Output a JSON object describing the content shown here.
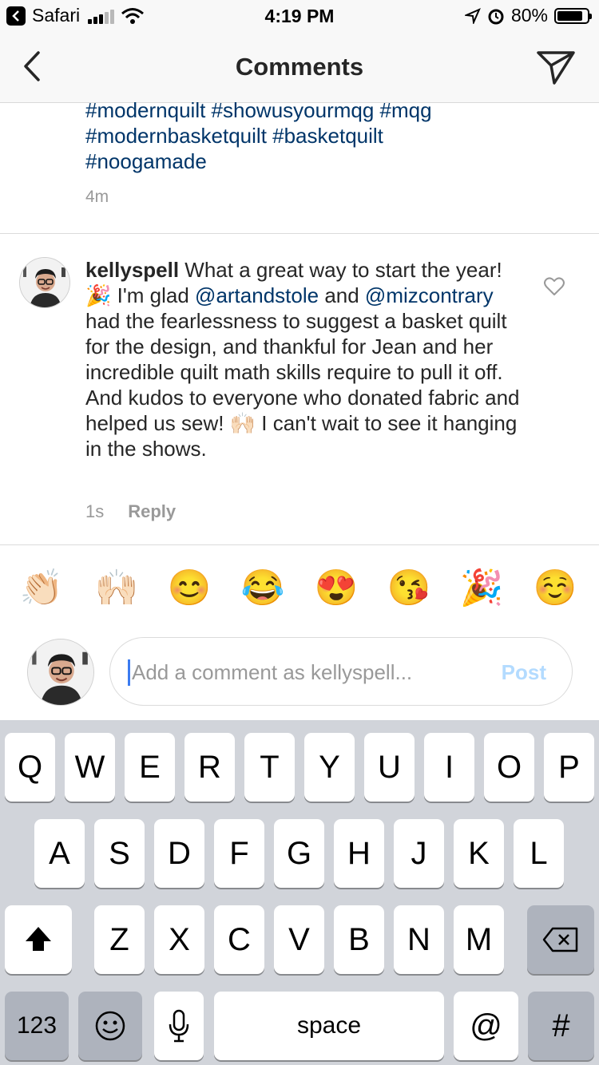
{
  "status_bar": {
    "back_app": "Safari",
    "time": "4:19 PM",
    "battery": "80%",
    "battery_level": 0.8
  },
  "nav": {
    "title": "Comments",
    "back_icon": "chevron-left-icon",
    "send_icon": "paper-plane-icon"
  },
  "previous_comment": {
    "hashtags_line1": "#modernquilt #showusyourmqg #mqg",
    "hashtags_line2": "#modernbasketquilt #basketquilt",
    "hashtags_line3": "#noogamade",
    "time": "4m"
  },
  "comment": {
    "username": "kellyspell",
    "text_part1": " What a great way to start the year! 🎉 I'm glad ",
    "mention1": "@artandstole",
    "text_part2": " and ",
    "mention2": "@mizcontrary",
    "text_part3": " had the fearlessness to suggest a basket quilt for the design, and thankful for Jean and her incredible quilt math skills require to pull it off. And kudos to everyone who donated fabric and helped us sew! 🙌🏻 I can't wait to see it hanging in the shows.",
    "time": "1s",
    "reply": "Reply"
  },
  "emojis": [
    "👏🏻",
    "🙌🏻",
    "😊",
    "😂",
    "😍",
    "😘",
    "🎉",
    "☺️"
  ],
  "input": {
    "placeholder": "Add a comment as kellyspell...",
    "post": "Post"
  },
  "keyboard": {
    "row1": [
      "Q",
      "W",
      "E",
      "R",
      "T",
      "Y",
      "U",
      "I",
      "O",
      "P"
    ],
    "row2": [
      "A",
      "S",
      "D",
      "F",
      "G",
      "H",
      "J",
      "K",
      "L"
    ],
    "row3": [
      "Z",
      "X",
      "C",
      "V",
      "B",
      "N",
      "M"
    ],
    "numbers": "123",
    "emoji": "☺",
    "space": "space",
    "at": "@",
    "hash": "#"
  },
  "colors": {
    "link": "#003569",
    "post_disabled": "#b3dbff",
    "caret": "#3b7bf0",
    "keyboard_bg": "#d1d4da"
  }
}
